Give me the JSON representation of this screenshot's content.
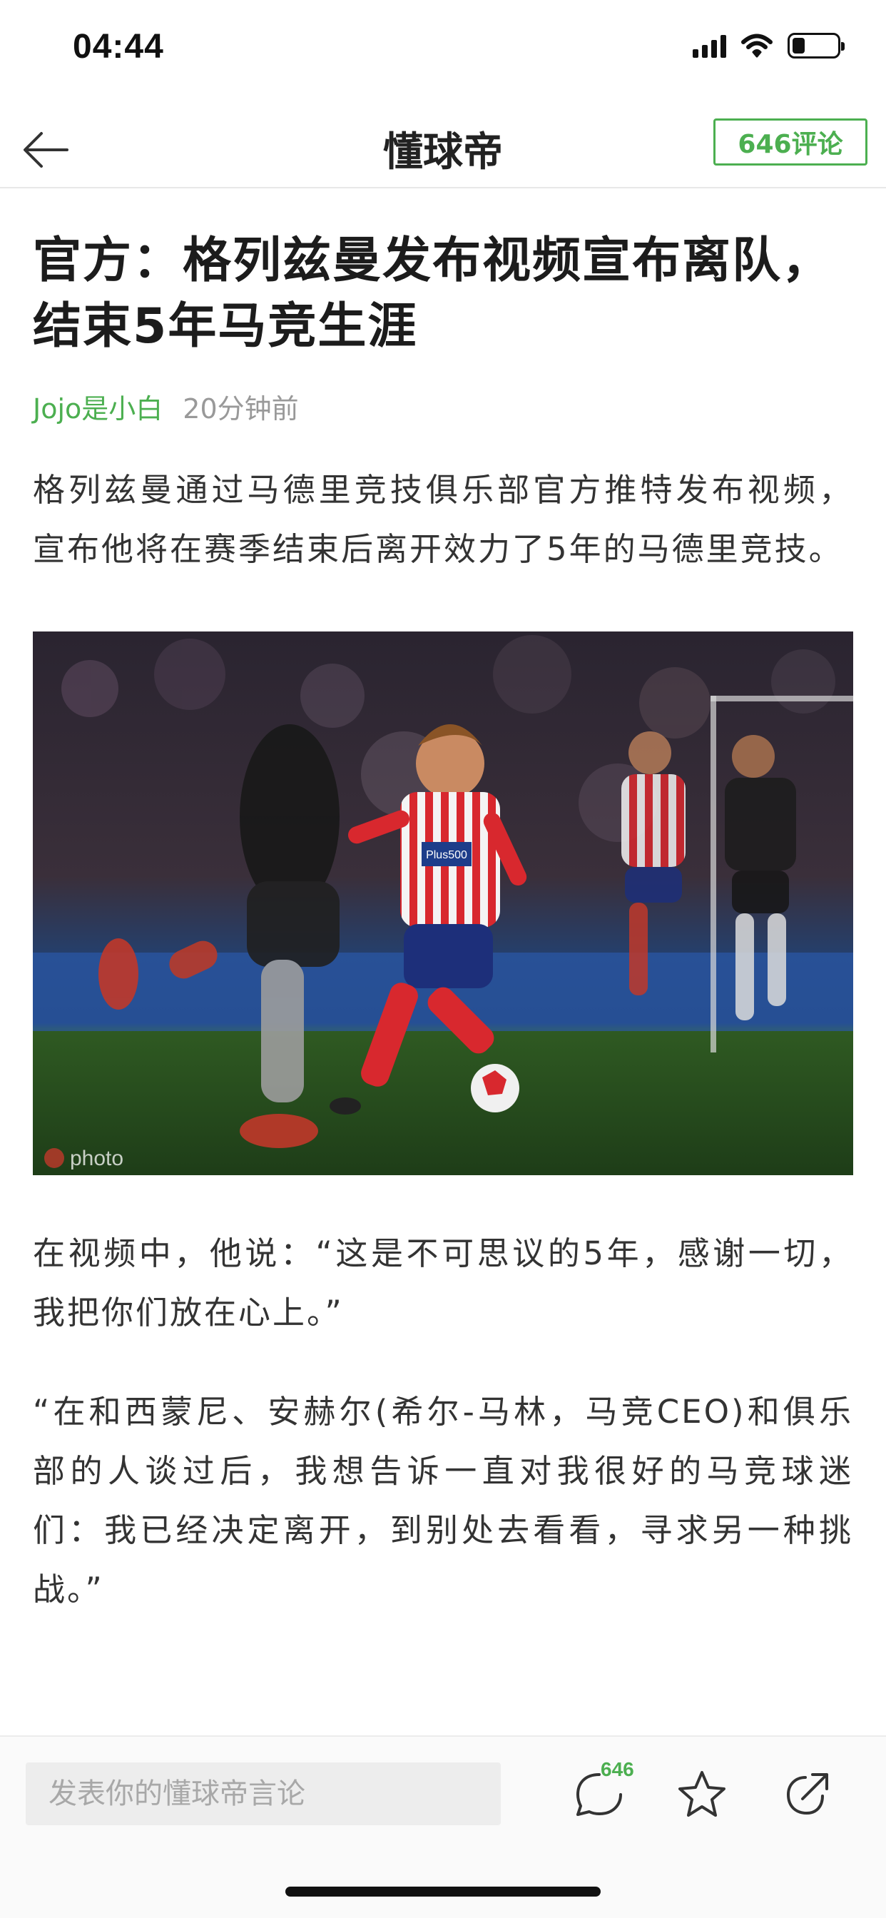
{
  "status_bar": {
    "time": "04:44",
    "icons": [
      "signal-icon",
      "wifi-icon",
      "battery-icon"
    ]
  },
  "nav": {
    "title": "懂球帝",
    "comments_label": "646评论",
    "back_icon": "arrow-left-icon"
  },
  "article": {
    "title": "官方：格列兹曼发布视频宣布离队，结束5年马竞生涯",
    "author": "Jojo是小白",
    "time": "20分钟前",
    "paragraphs": [
      "格列兹曼通过马德里竞技俱乐部官方推特发布视频，宣布他将在赛季结束后离开效力了5年的马德里竞技。",
      "在视频中，他说：“这是不可思议的5年，感谢一切，我把你们放在心上。”",
      "“在和西蒙尼、安赫尔(希尔-马林，马竞CEO)和俱乐部的人谈过后，我想告诉一直对我很好的马竞球迷们：我已经决定离开，到别处去看看，寻求另一种挑战。”"
    ],
    "photo": {
      "watermark": "photo",
      "jersey_text": "Plus500"
    }
  },
  "bottom_bar": {
    "input_placeholder": "发表你的懂球帝言论",
    "comment_count": "646",
    "icons": [
      "comment-bubble-icon",
      "star-icon",
      "share-icon"
    ]
  },
  "colors": {
    "accent": "#4caf50",
    "text": "#333333",
    "meta": "#999999"
  }
}
